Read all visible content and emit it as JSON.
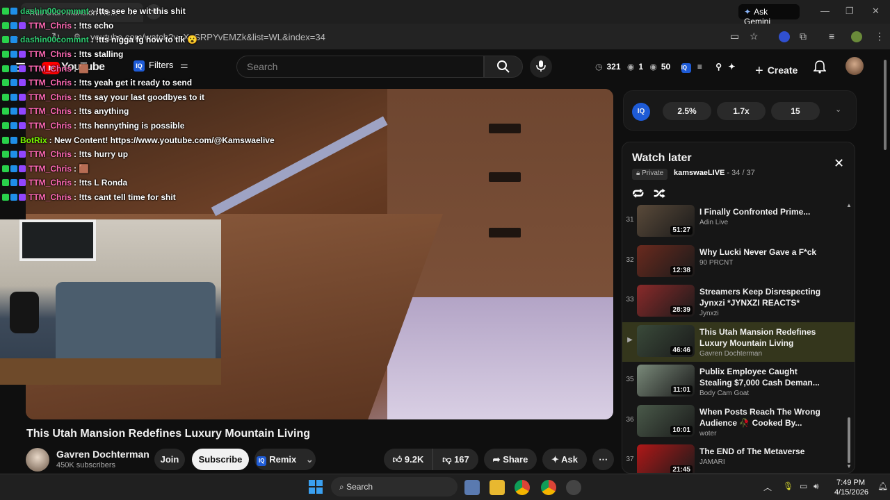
{
  "browser": {
    "tab_title": "This Utah Mansion Re...",
    "gemini_label": "Ask Gemini",
    "url": "youtube.com/watch?v=XpSRPYvEMZk&list=WL&index=34"
  },
  "header": {
    "logo_text": "YouTube",
    "filters_label": "Filters",
    "search_placeholder": "Search",
    "stat_clock": "321",
    "stat_eye1": "1",
    "stat_eye2": "50",
    "create_label": "Create"
  },
  "chat": [
    {
      "user": "dashin00commnt",
      "color": "#2ecc71",
      "msg": "!tts see he wit this shit",
      "b3": false
    },
    {
      "user": "TTM_Chris",
      "color": "#ff69b4",
      "msg": "!tts echo",
      "b3": true
    },
    {
      "user": "dashin00commnt",
      "color": "#2ecc71",
      "msg": "!tts nigga fg how to tlk 😮",
      "b3": false
    },
    {
      "user": "TTM_Chris",
      "color": "#ff69b4",
      "msg": "!tts stalling",
      "b3": true
    },
    {
      "user": "TTM_Chris",
      "color": "#ff69b4",
      "msg": "🟫",
      "b3": true
    },
    {
      "user": "TTM_Chris",
      "color": "#ff69b4",
      "msg": "!tts yeah get it ready to send",
      "b3": true
    },
    {
      "user": "TTM_Chris",
      "color": "#ff69b4",
      "msg": "!tts say your last goodbyes to it",
      "b3": true
    },
    {
      "user": "TTM_Chris",
      "color": "#ff69b4",
      "msg": "!tts anything",
      "b3": true
    },
    {
      "user": "TTM_Chris",
      "color": "#ff69b4",
      "msg": "!tts hennything is possible",
      "b3": true
    },
    {
      "user": "BotRix",
      "color": "#7cfc00",
      "msg": "New Content! https://www.youtube.com/@Kamswaelive",
      "b3": false
    },
    {
      "user": "TTM_Chris",
      "color": "#ff69b4",
      "msg": "!tts hurry up",
      "b3": true
    },
    {
      "user": "TTM_Chris",
      "color": "#ff69b4",
      "msg": "🟫",
      "b3": true
    },
    {
      "user": "TTM_Chris",
      "color": "#ff69b4",
      "msg": "!tts L Ronda",
      "b3": true
    },
    {
      "user": "TTM_Chris",
      "color": "#ff69b4",
      "msg": "!tts cant tell time for shit",
      "b3": true
    }
  ],
  "video": {
    "title": "This Utah Mansion Redefines Luxury Mountain Living",
    "channel": "Gavren Dochterman",
    "subscribers": "450K subscribers",
    "join_label": "Join",
    "subscribe_label": "Subscribe",
    "remix_label": "Remix",
    "likes": "9.2K",
    "dislikes": "167",
    "share_label": "Share",
    "ask_label": "Ask"
  },
  "iq": {
    "logo": "IQ",
    "chip1": "2.5%",
    "chip2": "1.7x",
    "chip3": "15"
  },
  "playlist": {
    "title": "Watch later",
    "privacy": "Private",
    "owner": "kamswaeLIVE",
    "position": " - 34 / 37",
    "items": [
      {
        "idx": "31",
        "title": "I Finally Confronted Prime...",
        "channel": "Adin Live",
        "duration": "51:27",
        "thumb": "#5a4a3a"
      },
      {
        "idx": "32",
        "title": "Why Lucki Never Gave a F*ck",
        "channel": "90 PRCNT",
        "duration": "12:38",
        "thumb": "#6a2a1e"
      },
      {
        "idx": "33",
        "title": "Streamers Keep Disrespecting Jynxzi *JYNXZI REACTS*",
        "channel": "Jynxzi",
        "duration": "28:39",
        "thumb": "#8a2a2a"
      },
      {
        "idx": "▶",
        "title": "This Utah Mansion Redefines Luxury Mountain Living",
        "channel": "Gavren Dochterman",
        "duration": "46:46",
        "thumb": "#3a4a3a"
      },
      {
        "idx": "35",
        "title": "Publix Employee Caught Stealing $7,000 Cash Deman...",
        "channel": "Body Cam Goat",
        "duration": "11:01",
        "thumb": "#7a8a7a"
      },
      {
        "idx": "36",
        "title": "When Posts Reach The Wrong Audience 🥀 Cooked By...",
        "channel": "woter",
        "duration": "10:01",
        "thumb": "#4a5a4a"
      },
      {
        "idx": "37",
        "title": "The END of The Metaverse",
        "channel": "JAMARI",
        "duration": "21:45",
        "thumb": "#b01818"
      }
    ]
  },
  "taskbar": {
    "search_label": "Search",
    "time": "7:49 PM",
    "date": "4/15/2026"
  }
}
